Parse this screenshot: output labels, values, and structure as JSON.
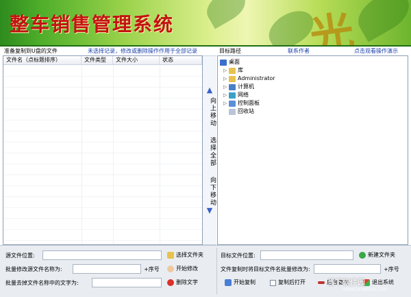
{
  "banner": {
    "title": "整车销售管理系统"
  },
  "left_header": {
    "label": "准备复制到U盘的文件",
    "hint": "未选择记录，修改或删除操作作用于全部记录"
  },
  "table": {
    "columns": [
      "文件名（点标题排序）",
      "文件类型",
      "文件大小",
      "状态"
    ]
  },
  "mover": {
    "up": "向上移动",
    "select_all": "选择全部",
    "down": "向下移动"
  },
  "right_header": {
    "label": "目标路径",
    "contact": "联系作者",
    "help": "点击观看操作演示"
  },
  "tree": {
    "root": "桌面",
    "items": [
      "库",
      "Administrator",
      "计算机",
      "网络",
      "控制面板",
      "回收站"
    ]
  },
  "bottom_left": {
    "source_label": "源文件位置:",
    "select_folder": "选择文件夹",
    "rename_label": "批量修改源文件名称为:",
    "seq_label": "+序号",
    "start_modify": "开始修改",
    "remove_label": "批量去掉文件名称中的文字为:",
    "delete_text": "删除文字"
  },
  "bottom_right": {
    "target_label": "目标文件位置:",
    "new_folder": "新建文件夹",
    "rename_label": "文件复制时将目标文件名批量修改为:",
    "seq_label": "+序号",
    "start_copy": "开始复制",
    "open_after": "复制后打开",
    "background_copy": "后台复制",
    "exit": "退出系统"
  },
  "watermark": {
    "text": "当下软件园",
    "sub": "WWW.DOWNXIA.COM"
  },
  "colors": {
    "accent_blue": "#1a3fa8",
    "banner_red": "#c41212",
    "banner_green": "#4fae2a"
  }
}
